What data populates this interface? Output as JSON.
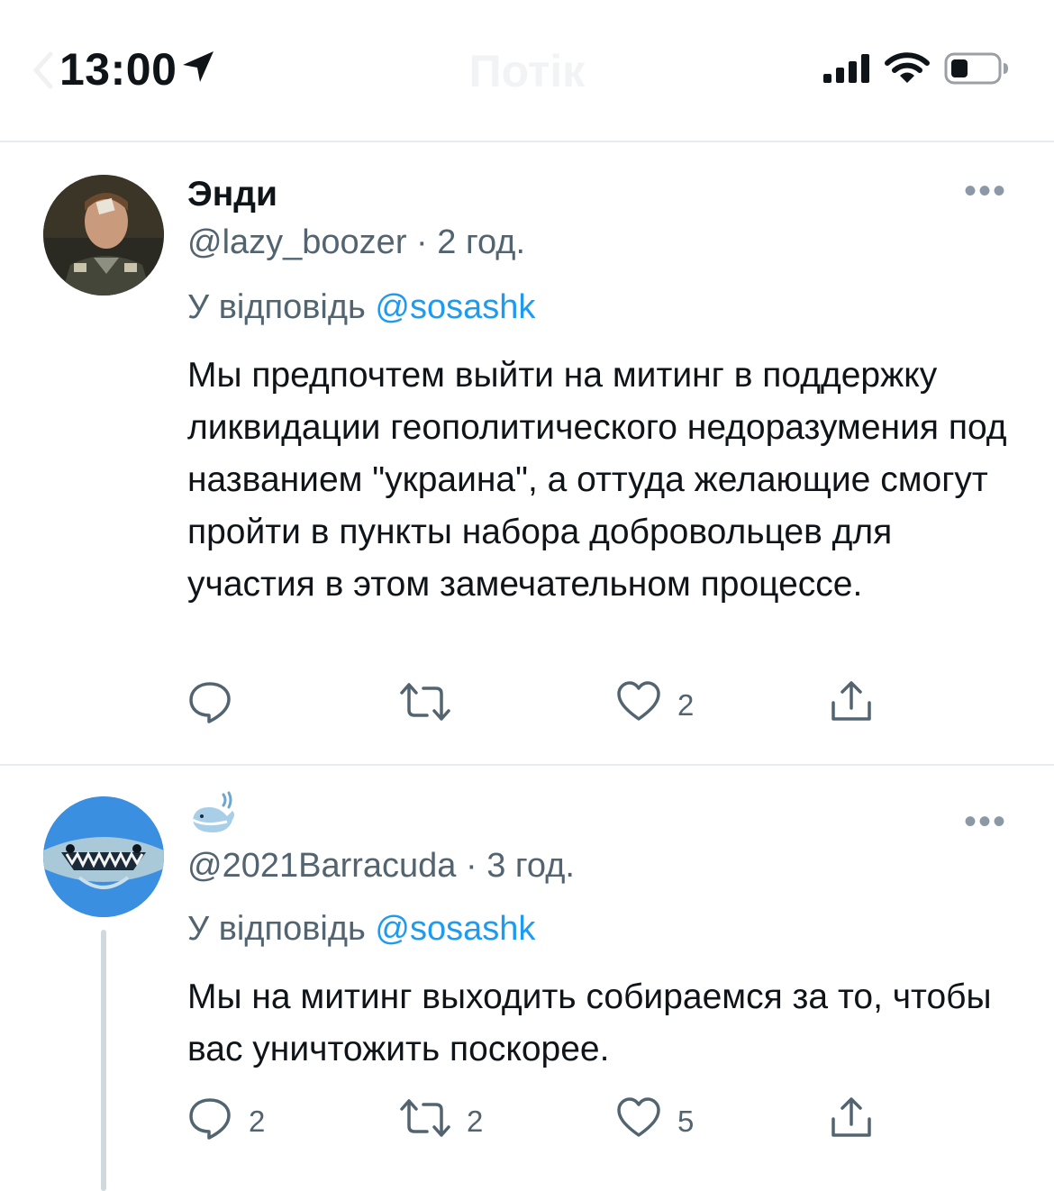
{
  "status_bar": {
    "time": "13:00",
    "ghost_title": "Потік",
    "icons": [
      "location-arrow-icon",
      "cellular-signal-icon",
      "wifi-icon",
      "battery-icon"
    ]
  },
  "tweets": [
    {
      "display_name": "Энди",
      "handle": "@lazy_boozer",
      "separator": "·",
      "time": "2 год.",
      "reply_prefix": "У відповідь",
      "reply_to": "@sosashk",
      "text": "Мы предпочтем выйти на митинг в поддержку ликвидации геополитического недоразумения под названием \"украина\", а оттуда желающие смогут пройти в пункты набора добровольцев для участия в этом замечательном процессе.",
      "counts": {
        "replies": "",
        "retweets": "",
        "likes": "2"
      }
    },
    {
      "display_name_icon": "whale-emoji-icon",
      "handle": "@2021Barracuda",
      "separator": "·",
      "time": "3 год.",
      "reply_prefix": "У відповідь",
      "reply_to": "@sosashk",
      "text": "Мы на митинг выходить собираемся за то, чтобы вас уничтожить поскорее.",
      "counts": {
        "replies": "2",
        "retweets": "2",
        "likes": "5"
      }
    }
  ],
  "colors": {
    "mention": "#1d9bf0",
    "secondary_text": "#536471",
    "divider": "#e6ecf0",
    "thread_line": "#cfd9de"
  }
}
